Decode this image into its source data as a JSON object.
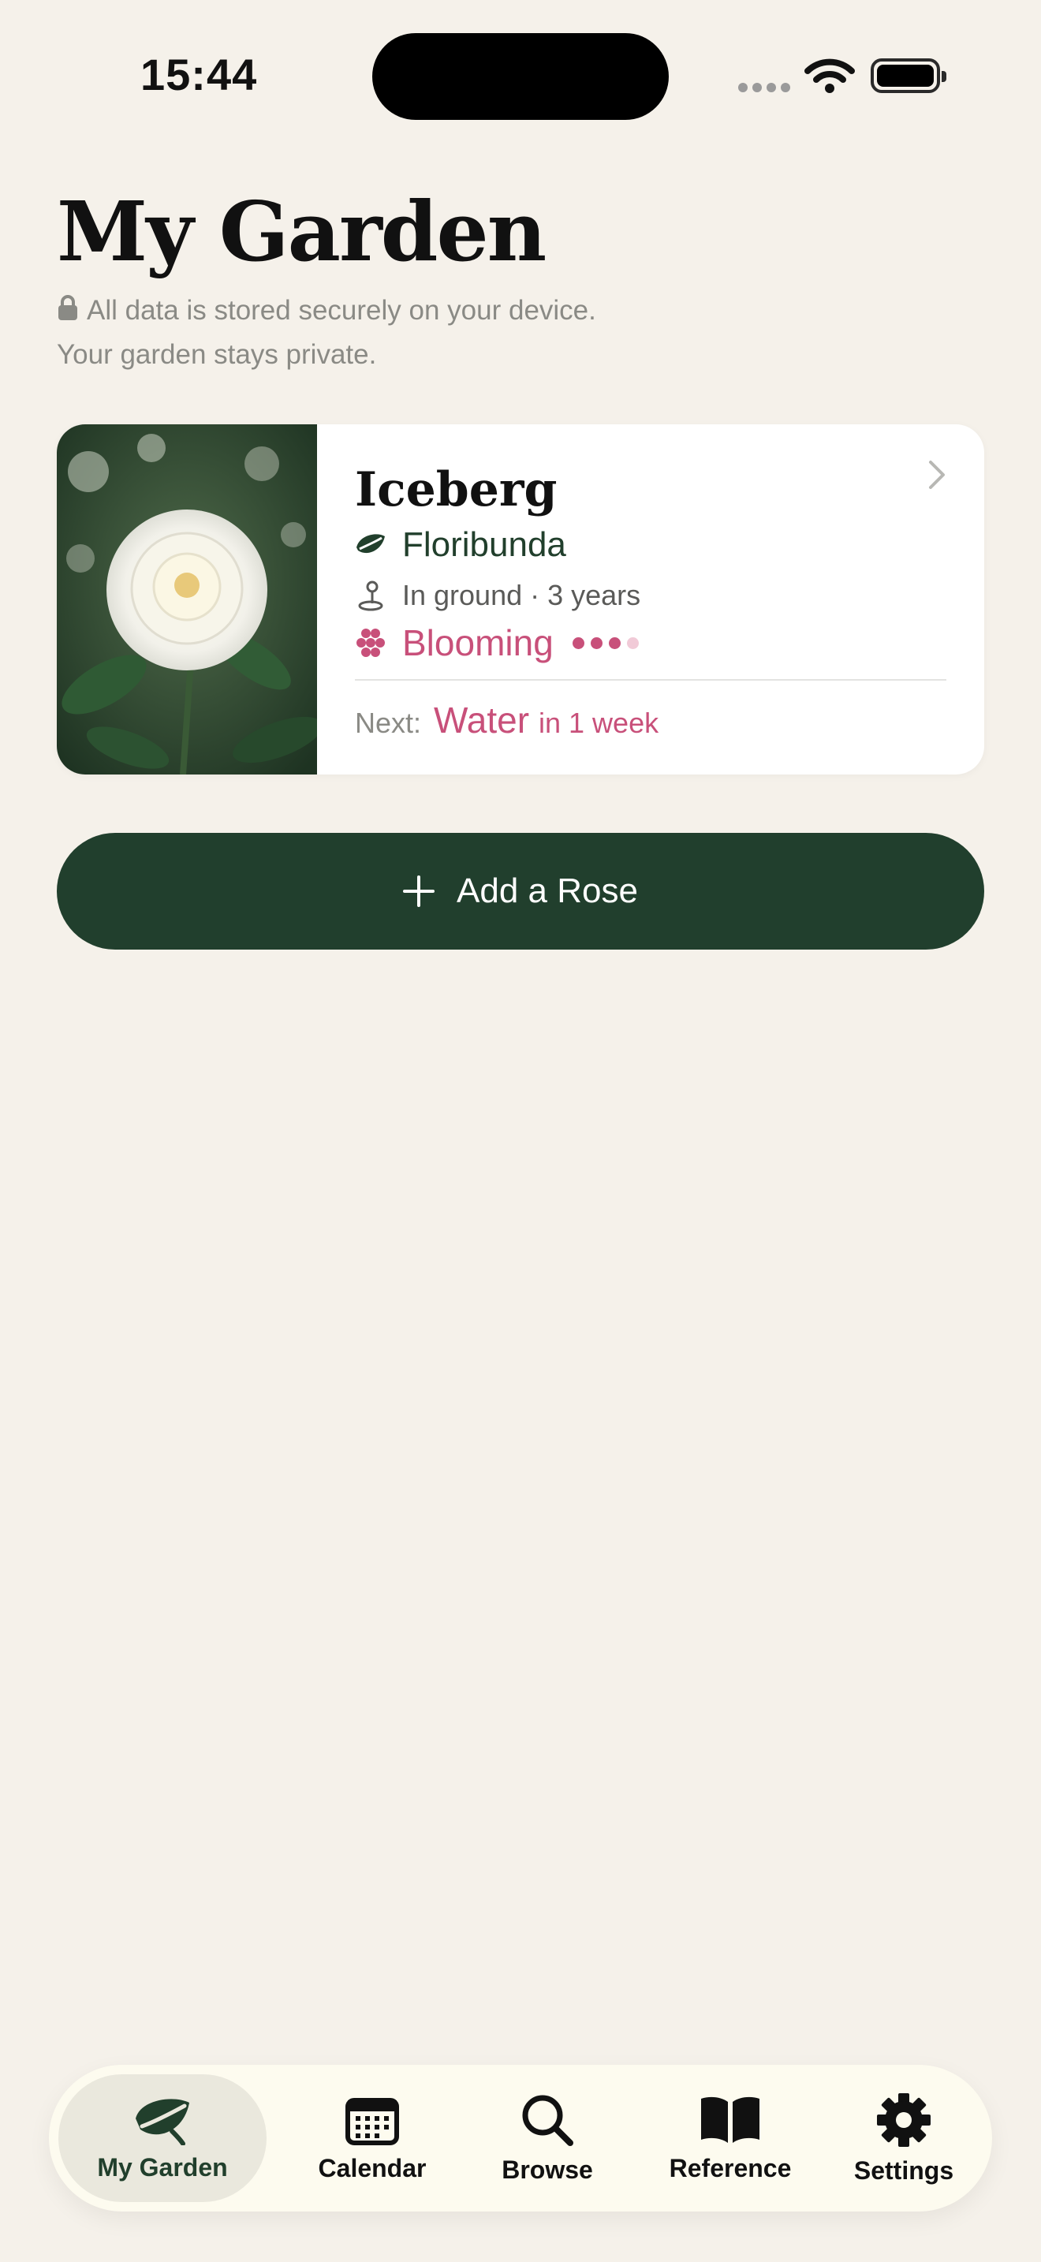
{
  "status_bar": {
    "time": "15:44"
  },
  "header": {
    "title": "My Garden",
    "privacy_line1": "All data is stored securely on your device.",
    "privacy_line2": "Your garden stays private."
  },
  "roses": [
    {
      "name": "Iceberg",
      "type": "Floribunda",
      "location": "In ground · 3 years",
      "status": "Blooming",
      "bloom_level": 3,
      "bloom_max": 4,
      "next_label": "Next:",
      "next_action": "Water",
      "next_when": "in 1 week"
    }
  ],
  "add_button": {
    "label": "Add a Rose"
  },
  "tabs": [
    {
      "label": "My Garden",
      "icon": "leaf-icon",
      "active": true
    },
    {
      "label": "Calendar",
      "icon": "calendar-icon",
      "active": false
    },
    {
      "label": "Browse",
      "icon": "search-icon",
      "active": false
    },
    {
      "label": "Reference",
      "icon": "book-icon",
      "active": false
    },
    {
      "label": "Settings",
      "icon": "gear-icon",
      "active": false
    }
  ],
  "colors": {
    "background": "#F5F1EA",
    "primary_green": "#213F2D",
    "accent_pink": "#C8507A",
    "tabbar_bg": "#FDFBEF"
  }
}
